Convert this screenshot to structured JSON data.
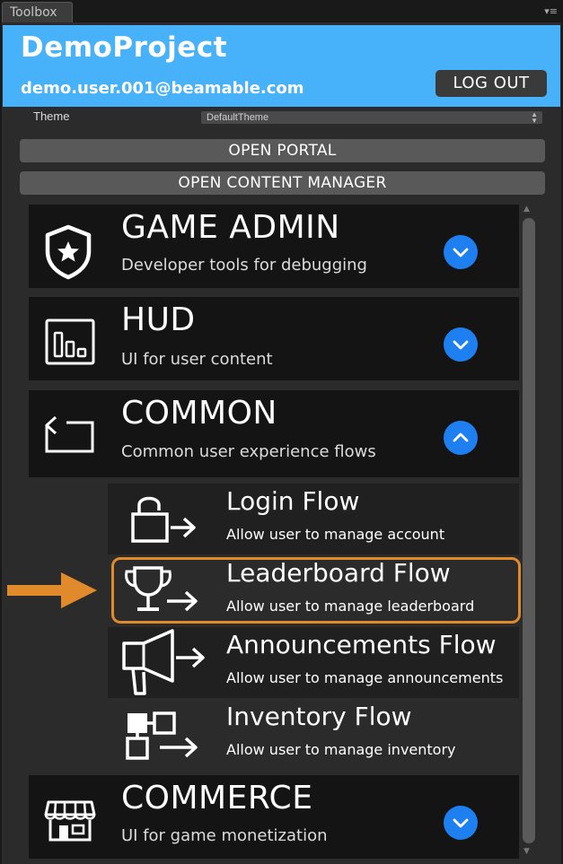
{
  "window": {
    "tab_title": "Toolbox",
    "tab_menu": "▾≡"
  },
  "header": {
    "project_name": "DemoProject",
    "user_email": "demo.user.001@beamable.com",
    "logout_label": "LOG OUT",
    "background_color": "#47b1fa"
  },
  "theme": {
    "label": "Theme",
    "selected": "DefaultTheme"
  },
  "buttons": {
    "open_portal": "OPEN PORTAL",
    "open_content_manager": "OPEN CONTENT MANAGER"
  },
  "categories": [
    {
      "title": "GAME ADMIN",
      "subtitle": "Developer tools for debugging",
      "icon": "shield-star-icon",
      "expanded": false
    },
    {
      "title": "HUD",
      "subtitle": "UI for user content",
      "icon": "bar-chart-icon",
      "expanded": false
    },
    {
      "title": "COMMON",
      "subtitle": "Common user experience flows",
      "icon": "return-arrow-icon",
      "expanded": true
    },
    {
      "title": "COMMERCE",
      "subtitle": "UI for game monetization",
      "icon": "storefront-icon",
      "expanded": false
    }
  ],
  "flows": [
    {
      "title": "Login Flow",
      "subtitle": "Allow user to manage account",
      "icon": "padlock-arrow-icon"
    },
    {
      "title": "Leaderboard Flow",
      "subtitle": "Allow user to manage leaderboard",
      "icon": "trophy-arrow-icon",
      "highlighted": true
    },
    {
      "title": "Announcements Flow",
      "subtitle": "Allow user to manage announcements",
      "icon": "megaphone-arrow-icon"
    },
    {
      "title": "Inventory Flow",
      "subtitle": "Allow user to manage inventory",
      "icon": "grid-arrow-icon"
    }
  ],
  "colors": {
    "accent_blue": "#1e7ff0",
    "highlight_orange": "#e08a2c"
  }
}
